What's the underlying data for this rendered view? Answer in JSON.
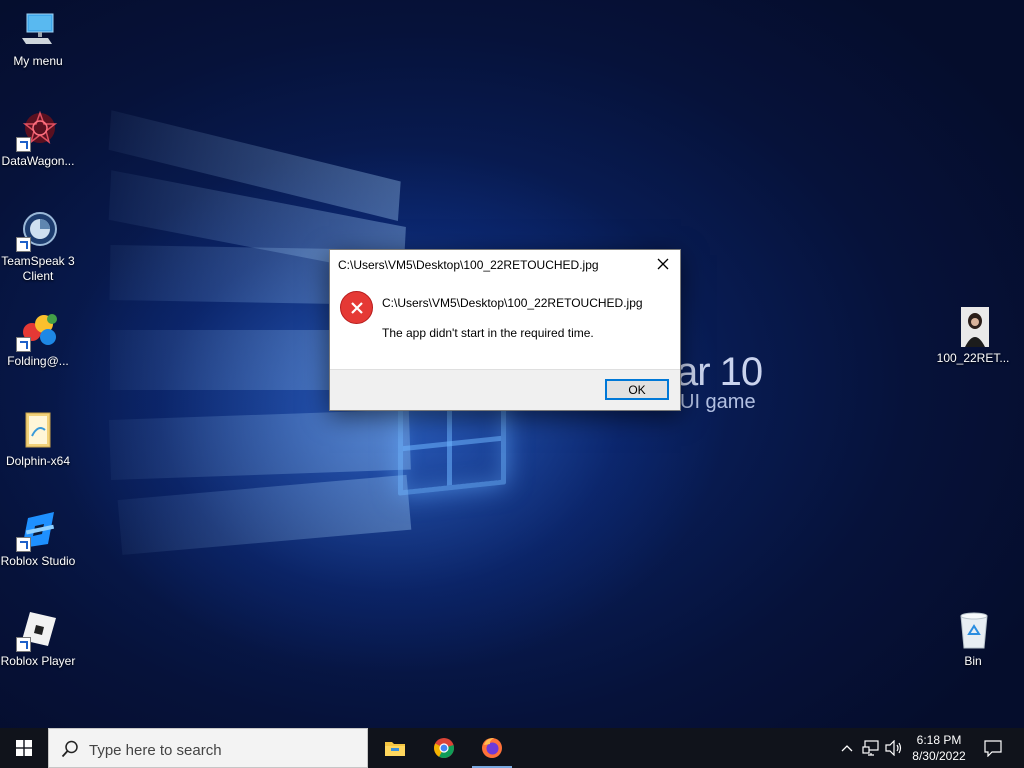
{
  "wallpaper": {
    "text_big": "ar 10",
    "text_small": "UI game"
  },
  "desktop_icons": [
    {
      "label": "My menu"
    },
    {
      "label": "DataWagon..."
    },
    {
      "label": "TeamSpeak 3 Client"
    },
    {
      "label": "Folding@..."
    },
    {
      "label": "Dolphin-x64"
    },
    {
      "label": "Roblox Studio"
    },
    {
      "label": "Roblox Player"
    },
    {
      "label": "100_22RET..."
    },
    {
      "label": "Bin"
    }
  ],
  "dialog": {
    "title": "C:\\Users\\VM5\\Desktop\\100_22RETOUCHED.jpg",
    "path": "C:\\Users\\VM5\\Desktop\\100_22RETOUCHED.jpg",
    "message": "The app didn't start in the required time.",
    "ok_label": "OK",
    "icon": "error-icon"
  },
  "taskbar": {
    "search_placeholder": "Type here to search",
    "pinned_apps": [
      "file-explorer-icon",
      "chrome-icon",
      "firefox-icon"
    ],
    "tray": {
      "time": "6:18 PM",
      "date": "8/30/2022"
    }
  },
  "colors": {
    "accent": "#0078d7",
    "error": "#e53935",
    "taskbar": "#10131b"
  }
}
